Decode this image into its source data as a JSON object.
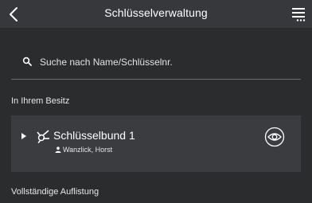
{
  "header": {
    "title": "Schlüsselverwaltung",
    "back_icon": "chevron-left-icon",
    "menu_icon": "menu-more-icon"
  },
  "search": {
    "placeholder": "Suche nach Name/Schlüsselnr.",
    "icon": "search-icon"
  },
  "sections": {
    "owned": "In Ihrem Besitz",
    "full_list": "Vollständige Auflistung"
  },
  "key_bundles": [
    {
      "name": "Schlüsselbund 1",
      "owner": "Wanzlick, Horst",
      "icon": "key-ring-icon",
      "owner_icon": "person-icon",
      "action_icon": "eye-icon"
    }
  ],
  "colors": {
    "background": "#2b2c2e",
    "header": "#37383c",
    "card": "#3b3c40",
    "text": "#ffffff"
  }
}
